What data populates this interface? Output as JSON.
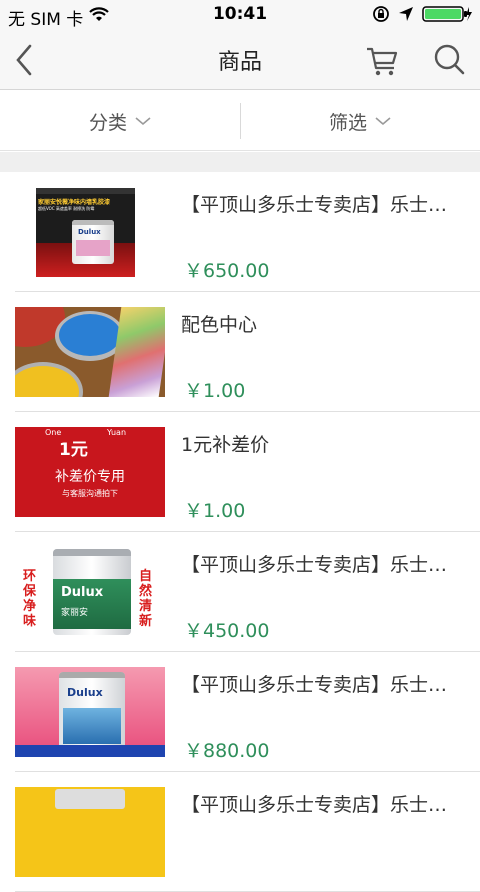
{
  "status_bar": {
    "carrier": "无 SIM 卡",
    "time": "10:41"
  },
  "nav": {
    "title": "商品"
  },
  "filters": {
    "category_label": "分类",
    "filter_label": "筛选"
  },
  "products": [
    {
      "title": "【平顶山多乐士专卖店】乐士专卖店",
      "price": "￥650.00"
    },
    {
      "title": "配色中心",
      "price": "￥1.00"
    },
    {
      "title": "1元补差价",
      "price": "￥1.00"
    },
    {
      "title": "【平顶山多乐士专卖店】乐士专卖店",
      "price": "￥450.00"
    },
    {
      "title": "【平顶山多乐士专卖店】乐士专卖店",
      "price": "￥880.00"
    },
    {
      "title": "【平顶山多乐士专卖店】乐士专卖店",
      "price": ""
    }
  ],
  "thumb_texts": {
    "p1_banner": "家丽安悦薇净味内墙乳胶漆",
    "p1_sub": "超低VOC 高遮盖率 耐擦洗 防霉",
    "brand": "Dulux",
    "p3_one": "One",
    "p3_yuan_en": "Yuan",
    "p3_big": "1元",
    "p3_main": "补差价专用",
    "p3_sub": "与客服沟通拍下",
    "p4_left": "环保净味",
    "p4_right": "自然清新",
    "p4_label": "家丽安"
  }
}
